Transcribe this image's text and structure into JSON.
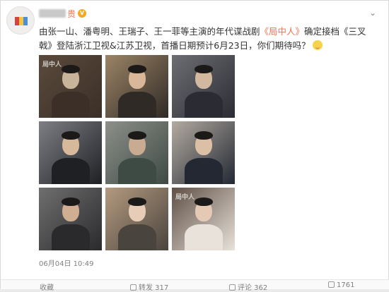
{
  "post": {
    "username_suffix": "贵",
    "verified_badge": "V",
    "text_before_highlight_1": "由张一山、潘粤明、王瑞子、王一菲等主演的年代谍战剧",
    "highlight_1": "《局中人》",
    "text_between": "确定接档《三叉戟》登陆浙江卫视&江苏卫视，首播日期预计6月23日，你们期待吗？",
    "timestamp": "06月04日 10:49",
    "emoji_icon": "smiling-face-emoji"
  },
  "images": [
    {
      "label": "局中人",
      "palette": [
        "#5a4a3c",
        "#3b2f27",
        "#c7b49b"
      ]
    },
    {
      "label": "",
      "palette": [
        "#9c8466",
        "#2f2a26",
        "#d9b799"
      ]
    },
    {
      "label": "",
      "palette": [
        "#6d6e73",
        "#2b2c33",
        "#d2b89f"
      ]
    },
    {
      "label": "",
      "palette": [
        "#7d7f84",
        "#1f2024",
        "#d6b89a"
      ]
    },
    {
      "label": "",
      "palette": [
        "#8d8f8a",
        "#3e4a44",
        "#c9ab92"
      ]
    },
    {
      "label": "",
      "palette": [
        "#b3aba1",
        "#232833",
        "#dcc0a6"
      ]
    },
    {
      "label": "",
      "palette": [
        "#6f6f6f",
        "#2a2a2d",
        "#cfae92"
      ]
    },
    {
      "label": "",
      "palette": [
        "#b49a7f",
        "#4a443e",
        "#e7cdb8"
      ]
    },
    {
      "label": "局中人",
      "palette": [
        "#5f4f45",
        "#e8e2da",
        "#e4c9b5"
      ]
    }
  ],
  "actions": {
    "favorite_label": "收藏",
    "repost_label": "转发 317",
    "comment_label": "评论 362",
    "like_label": "1761"
  }
}
